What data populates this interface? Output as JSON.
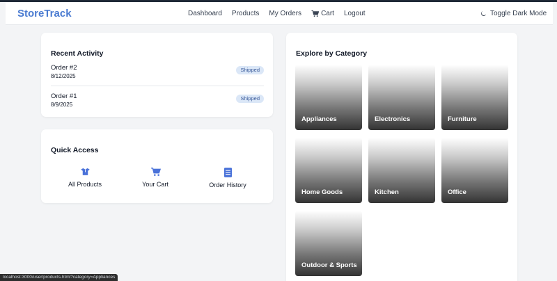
{
  "app": {
    "brand": "StoreTrack"
  },
  "nav": {
    "links": [
      {
        "label": "Dashboard"
      },
      {
        "label": "Products"
      },
      {
        "label": "My Orders"
      },
      {
        "label": "Cart",
        "icon": "cart-icon"
      },
      {
        "label": "Logout"
      }
    ],
    "dark_mode_label": "Toggle Dark Mode",
    "dark_mode_icon": "moon-icon"
  },
  "recent_activity": {
    "title": "Recent Activity",
    "orders": [
      {
        "name": "Order #2",
        "date": "8/12/2025",
        "status": "Shipped"
      },
      {
        "name": "Order #1",
        "date": "8/9/2025",
        "status": "Shipped"
      }
    ]
  },
  "quick_access": {
    "title": "Quick Access",
    "items": [
      {
        "label": "All Products",
        "icon": "box-icon"
      },
      {
        "label": "Your Cart",
        "icon": "cart-icon"
      },
      {
        "label": "Order History",
        "icon": "document-icon"
      }
    ]
  },
  "explore": {
    "title": "Explore by Category",
    "categories": [
      "Appliances",
      "Electronics",
      "Furniture",
      "Home Goods",
      "Kitchen",
      "Office",
      "Outdoor & Sports"
    ]
  },
  "status_bar": {
    "url": "localhost:3000/user/products.html?category=Appliances"
  },
  "colors": {
    "brand": "#4a7bd1",
    "icon_accent": "#4a72d9",
    "badge_bg": "#dbe7f7",
    "badge_text": "#3b5b9a"
  }
}
